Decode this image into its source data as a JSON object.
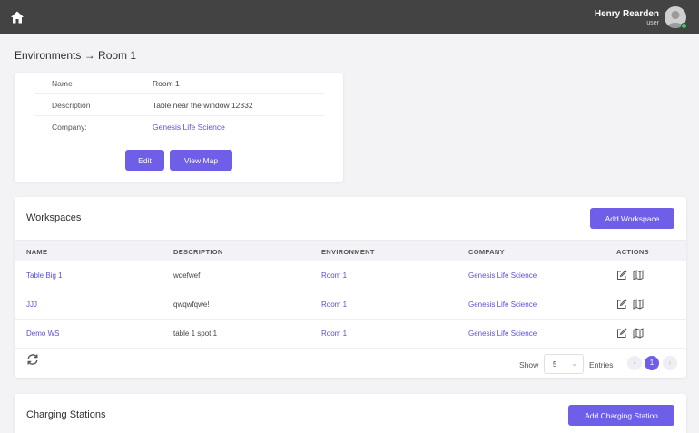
{
  "header": {
    "user_name": "Henry Rearden",
    "user_role": "user",
    "status_color": "#3fcf6a",
    "home_icon": "home-icon",
    "avatar_icon": "user-avatar-icon"
  },
  "breadcrumb": "Environments → Room 1",
  "details": {
    "rows": [
      {
        "label": "Name",
        "value": "Room 1"
      },
      {
        "label": "Description",
        "value": "Table near the window 12332"
      },
      {
        "label": "Company:",
        "value": "Genesis Life Science"
      }
    ],
    "edit_label": "Edit",
    "view_map_label": "View Map"
  },
  "workspaces": {
    "title": "Workspaces",
    "add_label": "Add Workspace",
    "columns": [
      "NAME",
      "DESCRIPTION",
      "ENVIRONMENT",
      "COMPANY",
      "ACTIONS"
    ],
    "rows": [
      {
        "name": "Table Big 1",
        "description": "wqefwef",
        "environment": "Room 1",
        "company": "Genesis Life Science"
      },
      {
        "name": "JJJ",
        "description": "qwqwfqwe!",
        "environment": "Room 1",
        "company": "Genesis Life Science"
      },
      {
        "name": "Demo WS",
        "description": "table 1 spot 1",
        "environment": "Room 1",
        "company": "Genesis Life Science"
      }
    ],
    "show_label": "Show",
    "entries_value": "5",
    "entries_label": "Entries",
    "prev_label": "‹",
    "current_page": "1",
    "next_label": "›"
  },
  "charging": {
    "title": "Charging Stations",
    "add_label": "Add Charging Station"
  },
  "colors": {
    "accent": "#6e5ee8",
    "link": "#5b4fd9",
    "topbar": "#434343"
  }
}
